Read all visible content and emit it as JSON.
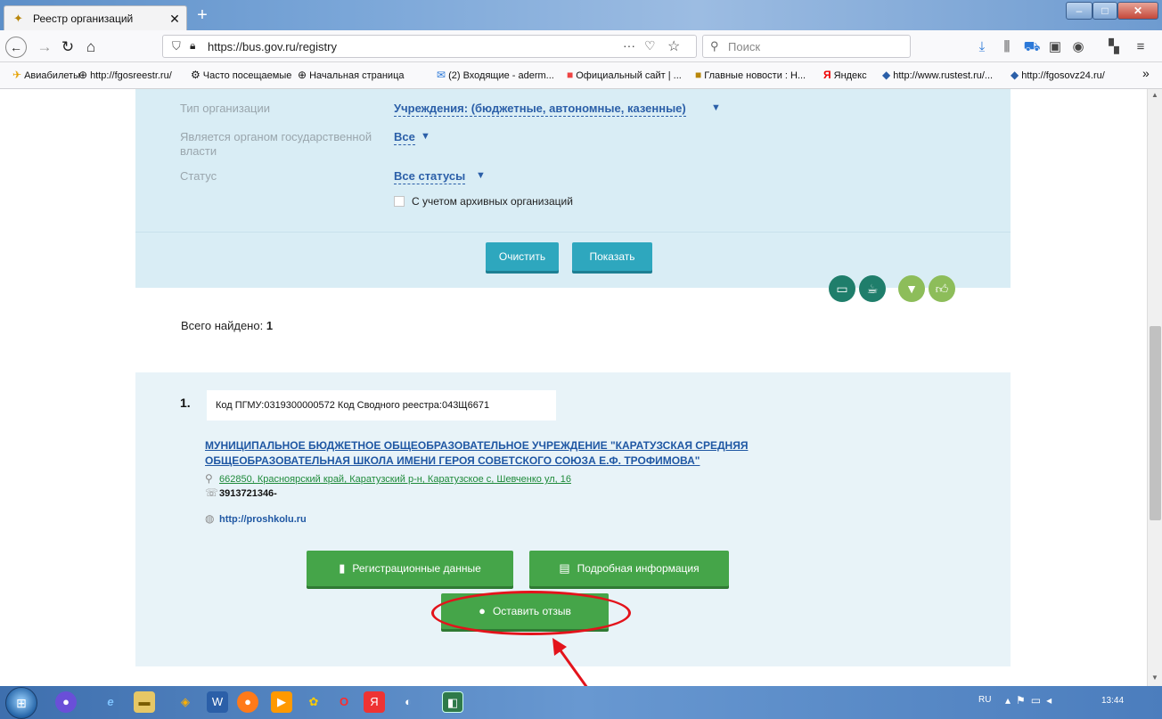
{
  "browser": {
    "tab_title": "Реестр организаций",
    "url": "https://bus.gov.ru/registry",
    "url_more": "···",
    "search_placeholder": "Поиск",
    "bookmarks": [
      {
        "label": "Авиабилеты",
        "icon": "plane-icon"
      },
      {
        "label": "http://fgosreestr.ru/",
        "icon": "globe-icon"
      },
      {
        "label": "Часто посещаемые",
        "icon": "gear-icon"
      },
      {
        "label": "Начальная страница",
        "icon": "globe-icon"
      },
      {
        "label": "(2) Входящие - aderm...",
        "icon": "mail-icon"
      },
      {
        "label": "Официальный сайт | ...",
        "icon": "bookmark-icon"
      },
      {
        "label": "Главные новости : Н...",
        "icon": "news-icon"
      },
      {
        "label": "Яндекс",
        "icon": "yandex-icon"
      },
      {
        "label": "http://www.rustest.ru/...",
        "icon": "site-icon"
      },
      {
        "label": "http://fgosovz24.ru/",
        "icon": "site-icon"
      }
    ],
    "bookmarks_overflow": "»"
  },
  "filters": {
    "org_type_label": "Тип организации",
    "org_type_value": "Учреждения: (бюджетные, автономные, казенные)",
    "gov_label_line1": "Является органом государственной",
    "gov_label_line2": "власти",
    "gov_value": "Все",
    "status_label": "Статус",
    "status_value": "Все статусы",
    "archive_label": "С учетом архивных организаций",
    "clear_button": "Очистить",
    "show_button": "Показать"
  },
  "results": {
    "found_label": "Всего найдено:",
    "found_count": "1",
    "items": [
      {
        "number": "1.",
        "codes": "Код ПГМУ:0319300000572 Код Сводного реестра:043Щ6671",
        "name_line1": "МУНИЦИПАЛЬНОЕ БЮДЖЕТНОЕ ОБЩЕОБРАЗОВАТЕЛЬНОЕ УЧРЕЖДЕНИЕ \"КАРАТУЗСКАЯ СРЕДНЯЯ",
        "name_line2": "ОБЩЕОБРАЗОВАТЕЛЬНАЯ ШКОЛА ИМЕНИ ГЕРОЯ СОВЕТСКОГО СОЮЗА Е.Ф. ТРОФИМОВА\"",
        "address": "662850, Красноярский край, Каратузский р-н, Каратузское с, Шевченко ул, 16",
        "phone": "3913721346-",
        "website": "http://proshkolu.ru",
        "btn_registration": "Регистрационные данные",
        "btn_details": "Подробная информация",
        "btn_review": "Оставить отзыв"
      }
    ]
  },
  "taskbar": {
    "lang": "RU",
    "clock": "13:44"
  },
  "colors": {
    "filter_bg": "#d9edf5",
    "teal_button": "#2ea7be",
    "green_button": "#45a549",
    "link_blue": "#1f57a3",
    "address_green": "#1e8a3a",
    "annotation_red": "#e3131b"
  }
}
